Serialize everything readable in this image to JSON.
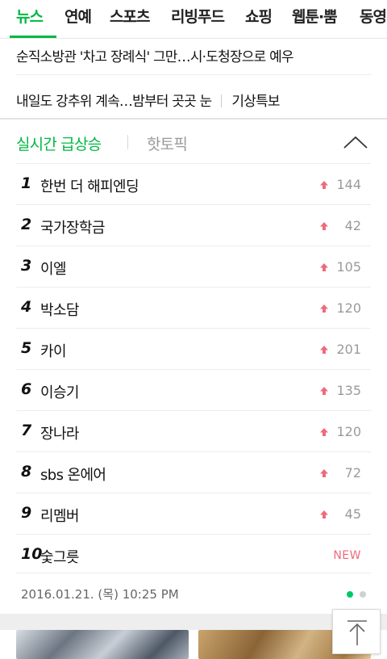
{
  "tabs": [
    "뉴스",
    "연예",
    "스포츠",
    "리빙푸드",
    "쇼핑",
    "웹툰·뿜",
    "동영"
  ],
  "headlines": [
    {
      "text": "순직소방관 '차고 장례식' 그만…시·도청장으로 예우"
    },
    {
      "text": "내일도 강추위 계속…밤부터 곳곳 눈",
      "tag": "기상특보"
    }
  ],
  "realtime": {
    "title": "실시간 급상승",
    "hot_tab": "핫토픽",
    "toggle_icon": "chevron-up-icon",
    "items": [
      {
        "rank": "1",
        "keyword": "한번 더 해피엔딩",
        "change": "144"
      },
      {
        "rank": "2",
        "keyword": "국가장학금",
        "change": "42"
      },
      {
        "rank": "3",
        "keyword": "이엘",
        "change": "105"
      },
      {
        "rank": "4",
        "keyword": "박소담",
        "change": "120"
      },
      {
        "rank": "5",
        "keyword": "카이",
        "change": "201"
      },
      {
        "rank": "6",
        "keyword": "이승기",
        "change": "135"
      },
      {
        "rank": "7",
        "keyword": "장나라",
        "change": "120"
      },
      {
        "rank": "8",
        "keyword": "sbs 온에어",
        "change": "72"
      },
      {
        "rank": "9",
        "keyword": "리멤버",
        "change": "45"
      },
      {
        "rank": "10",
        "keyword": "숯그릇",
        "badge": "NEW"
      }
    ],
    "timestamp": "2016.01.21. (목) 10:25 PM"
  },
  "colors": {
    "accent": "#00b843",
    "up_arrow": "#f06a7a",
    "new_badge": "#f06a7a"
  },
  "scroll_top_icon": "arrow-up-icon"
}
